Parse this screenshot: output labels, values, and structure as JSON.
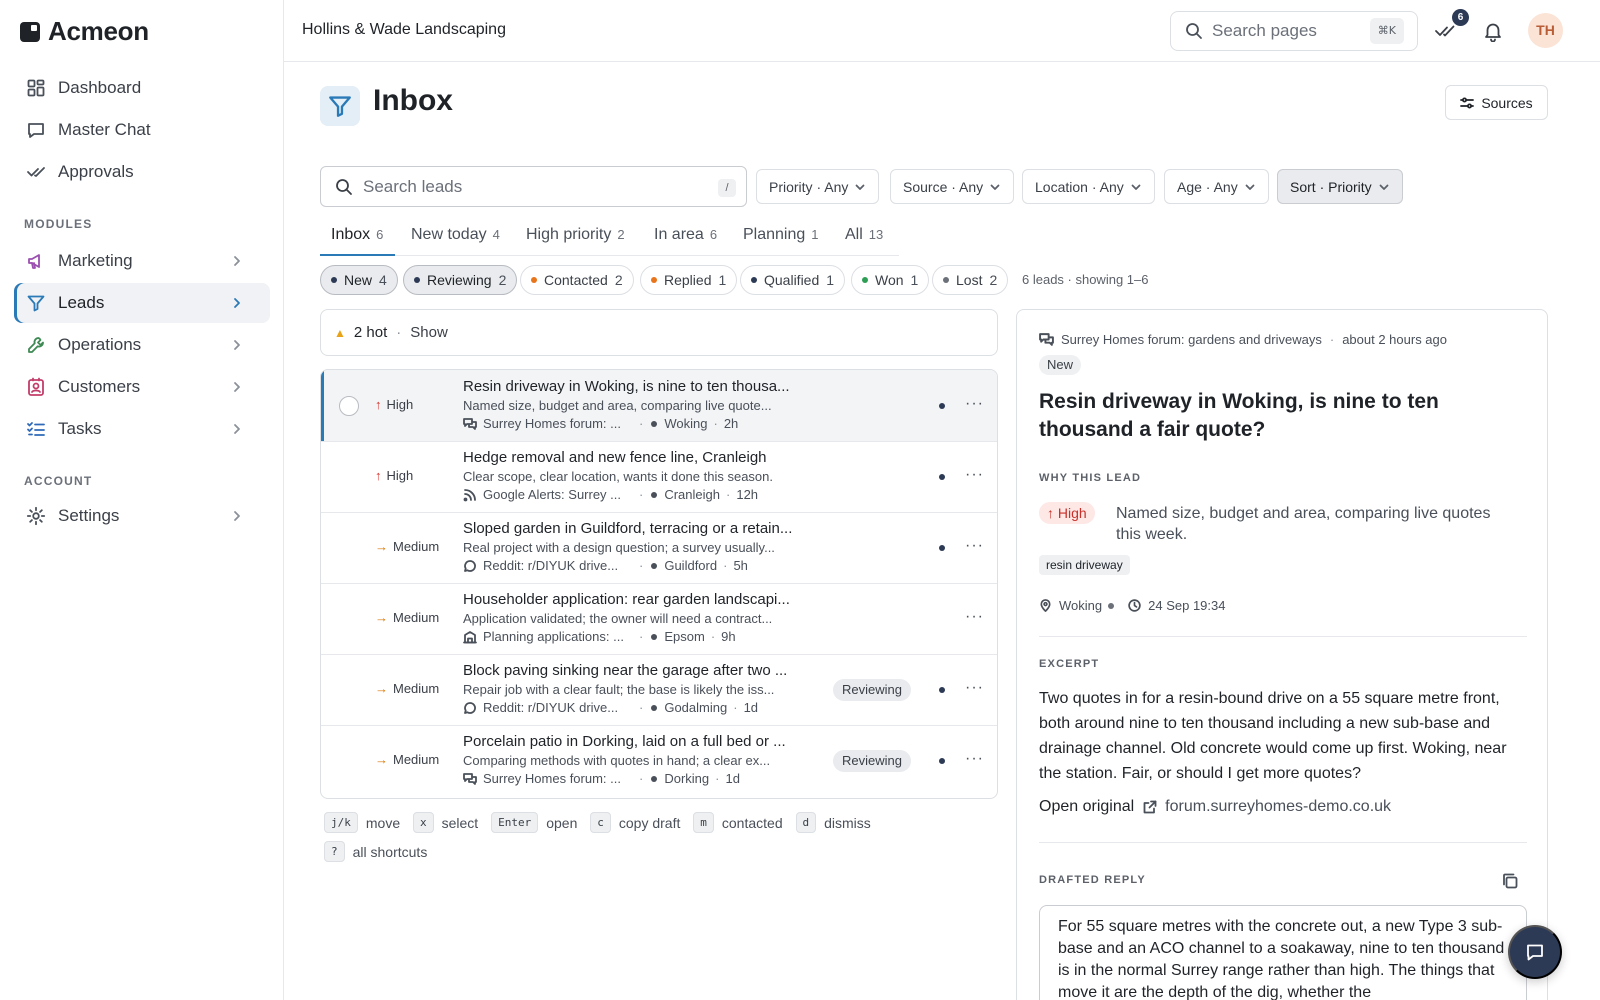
{
  "brand": {
    "name": "Acmeon"
  },
  "sidebar": {
    "nav": [
      {
        "label": "Dashboard",
        "icon": "grid-icon"
      },
      {
        "label": "Master Chat",
        "icon": "chat-icon"
      },
      {
        "label": "Approvals",
        "icon": "check-double-icon"
      }
    ],
    "modules_heading": "MODULES",
    "modules": [
      {
        "label": "Marketing",
        "icon": "megaphone-icon"
      },
      {
        "label": "Leads",
        "icon": "filter-icon",
        "active": true
      },
      {
        "label": "Operations",
        "icon": "wrench-icon"
      },
      {
        "label": "Customers",
        "icon": "contact-icon"
      },
      {
        "label": "Tasks",
        "icon": "checklist-icon"
      }
    ],
    "account_heading": "ACCOUNT",
    "account": [
      {
        "label": "Settings",
        "icon": "gear-icon"
      }
    ]
  },
  "topbar": {
    "workspace": "Hollins & Wade Landscaping",
    "search_placeholder": "Search pages",
    "search_shortcut": "⌘K",
    "approvals_count": "6",
    "avatar_initials": "TH"
  },
  "page": {
    "title": "Inbox",
    "sources_label": "Sources"
  },
  "filters": {
    "search_placeholder": "Search leads",
    "search_shortcut": "/",
    "priority": "Priority · Any",
    "source": "Source · Any",
    "location": "Location · Any",
    "age": "Age · Any",
    "sort": "Sort · Priority"
  },
  "tabs": [
    {
      "label": "Inbox",
      "count": "6"
    },
    {
      "label": "New today",
      "count": "4"
    },
    {
      "label": "High priority",
      "count": "2"
    },
    {
      "label": "In area",
      "count": "6"
    },
    {
      "label": "Planning",
      "count": "1"
    },
    {
      "label": "All",
      "count": "13"
    }
  ],
  "status_chips": [
    {
      "label": "New",
      "count": "4",
      "color": "#2d3a55"
    },
    {
      "label": "Reviewing",
      "count": "2",
      "color": "#2d3a55"
    },
    {
      "label": "Contacted",
      "count": "2",
      "color": "#e8741c"
    },
    {
      "label": "Replied",
      "count": "1",
      "color": "#e8741c"
    },
    {
      "label": "Qualified",
      "count": "1",
      "color": "#2d3a55"
    },
    {
      "label": "Won",
      "count": "1",
      "color": "#2f9e55"
    },
    {
      "label": "Lost",
      "count": "2",
      "color": "#6b7079"
    }
  ],
  "leads_summary": "6 leads · showing 1–6",
  "hot_banner": {
    "text": "2 hot",
    "sep": "·",
    "action": "Show"
  },
  "leads": [
    {
      "priority": "High",
      "title": "Resin driveway in Woking, is nine to ten thousa...",
      "summary": "Named size, budget and area, comparing live quote...",
      "source": "Surrey Homes forum: ...",
      "source_icon": "forum-icon",
      "location": "Woking",
      "age": "2h",
      "status": "",
      "unread": true
    },
    {
      "priority": "High",
      "title": "Hedge removal and new fence line, Cranleigh",
      "summary": "Clear scope, clear location, wants it done this season.",
      "source": "Google Alerts: Surrey ...",
      "source_icon": "rss-icon",
      "location": "Cranleigh",
      "age": "12h",
      "status": "",
      "unread": true
    },
    {
      "priority": "Medium",
      "title": "Sloped garden in Guildford, terracing or a retain...",
      "summary": "Real project with a design question; a survey usually...",
      "source": "Reddit: r/DIYUK drive...",
      "source_icon": "comment-icon",
      "location": "Guildford",
      "age": "5h",
      "status": "",
      "unread": true
    },
    {
      "priority": "Medium",
      "title": "Householder application: rear garden landscapi...",
      "summary": "Application validated; the owner will need a contract...",
      "source": "Planning applications: ...",
      "source_icon": "building-icon",
      "location": "Epsom",
      "age": "9h",
      "status": "",
      "unread": false
    },
    {
      "priority": "Medium",
      "title": "Block paving sinking near the garage after two ...",
      "summary": "Repair job with a clear fault; the base is likely the iss...",
      "source": "Reddit: r/DIYUK drive...",
      "source_icon": "comment-icon",
      "location": "Godalming",
      "age": "1d",
      "status": "Reviewing",
      "unread": true
    },
    {
      "priority": "Medium",
      "title": "Porcelain patio in Dorking, laid on a full bed or ...",
      "summary": "Comparing methods with quotes in hand; a clear ex...",
      "source": "Surrey Homes forum: ...",
      "source_icon": "forum-icon",
      "location": "Dorking",
      "age": "1d",
      "status": "Reviewing",
      "unread": true
    }
  ],
  "shortcuts": [
    {
      "key": "j/k",
      "label": "move"
    },
    {
      "key": "x",
      "label": "select"
    },
    {
      "key": "Enter",
      "label": "open"
    },
    {
      "key": "c",
      "label": "copy draft"
    },
    {
      "key": "m",
      "label": "contacted"
    },
    {
      "key": "d",
      "label": "dismiss"
    },
    {
      "key": "?",
      "label": "all shortcuts"
    }
  ],
  "detail": {
    "source": "Surrey Homes forum: gardens and driveways",
    "time": "about 2 hours ago",
    "status": "New",
    "title": "Resin driveway in Woking, is nine to ten thousand a fair quote?",
    "why_heading": "WHY THIS LEAD",
    "priority": "↑ High",
    "why": "Named size, budget and area, comparing live quotes this week.",
    "tag": "resin driveway",
    "location": "Woking",
    "datetime": "24 Sep 19:34",
    "excerpt_heading": "EXCERPT",
    "excerpt": "Two quotes in for a resin-bound drive on a 55 square metre front, both around nine to ten thousand including a new sub-base and drainage channel. Old concrete would come up first. Woking, near the station. Fair, or should I get more quotes?",
    "open_label": "Open original",
    "domain": "forum.surreyhomes-demo.co.uk",
    "reply_heading": "DRAFTED REPLY",
    "reply": "For 55 square metres with the concrete out, a new Type 3 sub-base and an ACO channel to a soakaway, nine to ten thousand is in the normal Surrey range rather than high. The things that move it are the depth of the dig, whether the"
  }
}
